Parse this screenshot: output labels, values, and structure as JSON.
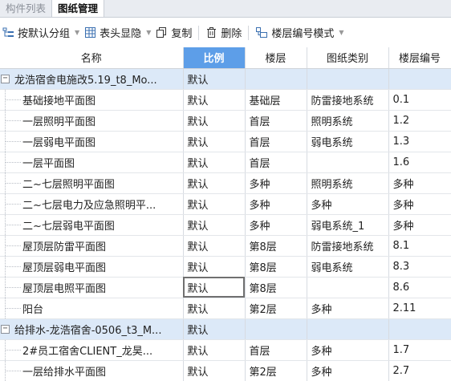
{
  "tabs": [
    {
      "label": "构件列表",
      "active": false
    },
    {
      "label": "图纸管理",
      "active": true
    }
  ],
  "toolbar": {
    "group_label": "按默认分组",
    "columns_label": "表头显隐",
    "copy_label": "复制",
    "delete_label": "删除",
    "floor_mode_label": "楼层编号模式"
  },
  "columns": [
    "名称",
    "比例",
    "楼层",
    "图纸类别",
    "楼层编号"
  ],
  "groups": [
    {
      "name": "龙浩宿舍电施改5.19_t8_Mo...",
      "scale": "默认",
      "rows": [
        {
          "name": "基础接地平面图",
          "scale": "默认",
          "floor": "基础层",
          "category": "防雷接地系统",
          "floor_no": "0.1"
        },
        {
          "name": "一层照明平面图",
          "scale": "默认",
          "floor": "首层",
          "category": "照明系统",
          "floor_no": "1.2"
        },
        {
          "name": "一层弱电平面图",
          "scale": "默认",
          "floor": "首层",
          "category": "弱电系统",
          "floor_no": "1.3"
        },
        {
          "name": "一层平面图",
          "scale": "默认",
          "floor": "首层",
          "category": "",
          "floor_no": "1.6"
        },
        {
          "name": "二~七层照明平面图",
          "scale": "默认",
          "floor": "多种",
          "category": "照明系统",
          "floor_no": "多种"
        },
        {
          "name": "二~七层电力及应急照明平...",
          "scale": "默认",
          "floor": "多种",
          "category": "多种",
          "floor_no": "多种"
        },
        {
          "name": "二~七层弱电平面图",
          "scale": "默认",
          "floor": "多种",
          "category": "弱电系统_1",
          "floor_no": "多种"
        },
        {
          "name": "屋顶层防雷平面图",
          "scale": "默认",
          "floor": "第8层",
          "category": "防雷接地系统",
          "floor_no": "8.1"
        },
        {
          "name": "屋顶层弱电平面图",
          "scale": "默认",
          "floor": "第8层",
          "category": "弱电系统",
          "floor_no": "8.3"
        },
        {
          "name": "屋顶层电照平面图",
          "scale": "默认",
          "floor": "第8层",
          "category": "",
          "floor_no": "8.6",
          "selected": true
        },
        {
          "name": "阳台",
          "scale": "默认",
          "floor": "第2层",
          "category": "多种",
          "floor_no": "2.11"
        }
      ]
    },
    {
      "name": "给排水-龙浩宿舍-0506_t3_M...",
      "scale": "默认",
      "rows": [
        {
          "name": "2#员工宿舍CLIENT_龙昊...",
          "scale": "默认",
          "floor": "首层",
          "category": "多种",
          "floor_no": "1.7"
        },
        {
          "name": "一层给排水平面图",
          "scale": "默认",
          "floor": "第2层",
          "category": "多种",
          "floor_no": "2.7"
        }
      ]
    }
  ],
  "colors": {
    "group_row": "#dce9f8",
    "sorted_header": "#5d9ee8"
  }
}
